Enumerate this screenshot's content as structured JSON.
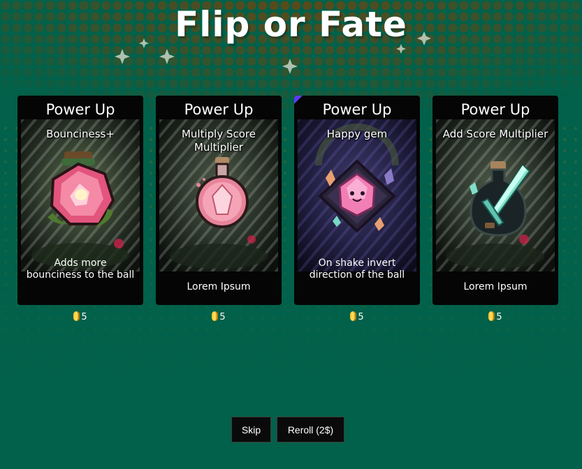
{
  "game": {
    "title": "Flip or Fate"
  },
  "colors": {
    "background": "#01614a",
    "pattern": "#5a4b1b",
    "card": "#050505",
    "button": "#0a0a0a",
    "coin": "#f6c21a",
    "selected_flag": "#5b3cf0"
  },
  "cards": [
    {
      "header": "Power Up",
      "name": "Bounciness+",
      "description": "Adds more bounciness to the ball",
      "price": "5",
      "icon": "pink-gem-potion-icon"
    },
    {
      "header": "Power Up",
      "name": "Multiply Score Multiplier",
      "description": "Lorem Ipsum",
      "price": "5",
      "icon": "pink-crystal-flask-icon"
    },
    {
      "header": "Power Up",
      "name": "Happy gem",
      "description": "On shake invert direction of the ball",
      "price": "5",
      "icon": "smiling-gem-icon",
      "selected": true
    },
    {
      "header": "Power Up",
      "name": "Add Score Multiplier",
      "description": "Lorem Ipsum",
      "price": "5",
      "icon": "crystal-sword-flask-icon"
    }
  ],
  "buttons": {
    "skip": "Skip",
    "reroll": "Reroll (2$)"
  }
}
